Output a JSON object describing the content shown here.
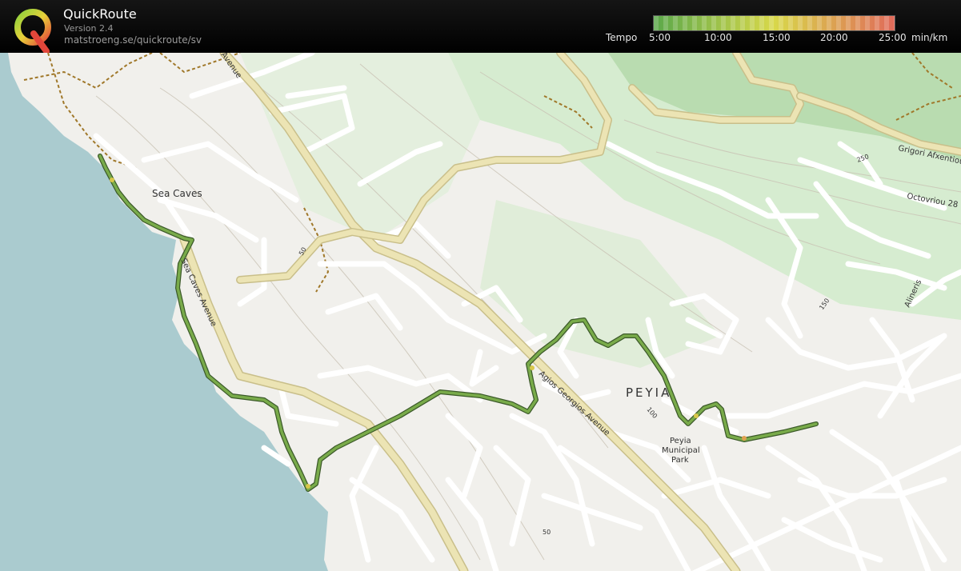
{
  "app": {
    "title": "QuickRoute",
    "version": "Version 2.4",
    "url": "matstroeng.se/quickroute/sv",
    "logo_letter": "Q"
  },
  "legend": {
    "label": "Tempo",
    "ticks": [
      "5:00",
      "10:00",
      "15:00",
      "20:00",
      "25:00"
    ],
    "unit": "min/km",
    "colors": [
      "#5aa84a",
      "#d8d84a",
      "#e06a5a"
    ]
  },
  "map": {
    "labels": {
      "sea_caves": "Sea Caves",
      "sea_caves_avenue": "Sea Caves Avenue",
      "agios_georgios_avenue": "Agios Georgios Avenue",
      "avenue_top": "Avenue",
      "peyia": "PEYIA",
      "park_line1": "Peyia",
      "park_line2": "Municipal",
      "park_line3": "Park",
      "grigori": "Grigori Afxentiou",
      "octovriou": "Octovriou 28",
      "alineris": "Alineris",
      "contour_50": "50",
      "contour_100": "100",
      "contour_150": "150",
      "contour_250": "250",
      "contour_50b": "50"
    },
    "colors": {
      "sea": "#aacbcf",
      "land": "#f1f0ec",
      "forest": "#c5e4bf",
      "main_road": "#ece4b4",
      "route": "#6a9a3c"
    }
  }
}
